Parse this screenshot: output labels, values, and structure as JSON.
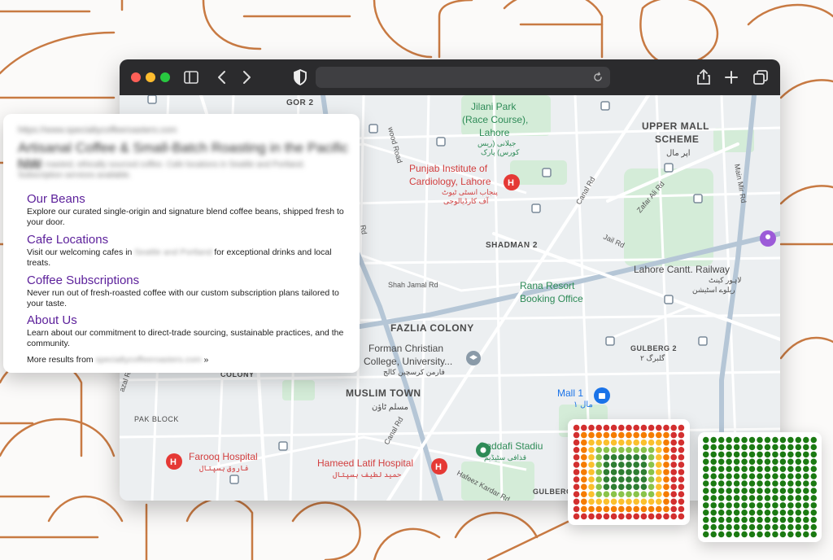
{
  "map": {
    "areas": {
      "gor2": "GOR 2",
      "upper_mall_1": "UPPER MALL",
      "upper_mall_2": "SCHEME",
      "upper_mall_ur": "اپر مال",
      "shadman": "SHADMAN 2",
      "fazlia": "FAZLIA COLONY",
      "muslim_town": "MUSLIM TOWN",
      "muslim_town_ur": "مسلم ٹاؤن",
      "pak_block": "PAK BLOCK",
      "gulberg2": "GULBERG 2",
      "gulberg2_ur": "گلبرگ ٢",
      "gulberg": "GULBERG",
      "colony": "COLONY"
    },
    "places": {
      "jilani_1": "Jilani Park",
      "jilani_2": "(Race Course),",
      "jilani_3": "Lahore",
      "jilani_ur1": "جیلانی (ریس",
      "jilani_ur2": "کورس) پارک",
      "punjab_1": "Punjab Institute of",
      "punjab_2": "Cardiology, Lahore",
      "punjab_ur1": "پنجاب انسٹی ٹیوٹ",
      "punjab_ur2": "آف کارڈیالوجی",
      "lahore_cantt": "Lahore Cantt. Railway",
      "lahore_cantt_ur1": "لاہور کینٹ",
      "lahore_cantt_ur2": "ریلوے اسٹیشن",
      "rana_1": "Rana Resort",
      "rana_2": "Booking Office",
      "forman_1": "Forman Christian",
      "forman_2": "College, University...",
      "forman_ur": "فارمن کرسچین کالج",
      "mall1": "Mall 1",
      "mall1_ur": "مال ١",
      "farooq": "Farooq Hospital",
      "farooq_ur": "فاروق ہسپتال",
      "hameed": "Hameed Latif Hospital",
      "hameed_ur": "حمید لطیف ہسپتال",
      "gaddafi": "Gaddafi Stadiu",
      "gaddafi_ur": "قذافی سٹیڈیم"
    },
    "roads": {
      "wood": "wood Road",
      "canal_top": "Canal Rd",
      "zafar": "Zafar Ali Rd",
      "jail": "Jail Rd",
      "main_mir": "Main Mir Rd",
      "shah_jamal": "Shah Jamal Rd",
      "canal_bottom": "Canal Rd",
      "hafeez": "Hafeez Kardar Rd",
      "azal": "azal R",
      "rd_left": "Rd"
    }
  },
  "serp": {
    "url": "https://www.specialtycoffeeroasters.com",
    "headline": "Artisanal Coffee & Small-Batch Roasting in the Pacific NW",
    "snippet": "Locally roasted, ethically sourced coffee. Cafe locations in Seattle and Portland. Subscription services available.",
    "sitelinks": [
      {
        "title": "Our Beans",
        "desc": "Explore our curated single-origin and signature blend coffee beans, shipped fresh to your door."
      },
      {
        "title": "Cafe Locations",
        "desc_pre": "Visit our welcoming cafes in",
        "desc_blur": "Seattle and Portland",
        "desc_post": "for exceptional drinks and local treats."
      },
      {
        "title": "Coffee Subscriptions",
        "desc": "Never run out of fresh-roasted coffee with our custom subscription plans tailored to your taste."
      },
      {
        "title": "About Us",
        "desc": "Learn about our commitment to direct-trade sourcing, sustainable practices, and the community."
      }
    ],
    "more_pre": "More results from",
    "more_blur": "specialtycoffeeroasters.com",
    "more_post": "»"
  },
  "heatmaps": {
    "left": {
      "description_values": "mixed ranking grid",
      "colors": [
        "#d32f2f",
        "#f57c00",
        "#fbc02d",
        "#8bc34a",
        "#2e7d32"
      ]
    },
    "right": {
      "colors": [
        "#1b7a12"
      ]
    }
  }
}
